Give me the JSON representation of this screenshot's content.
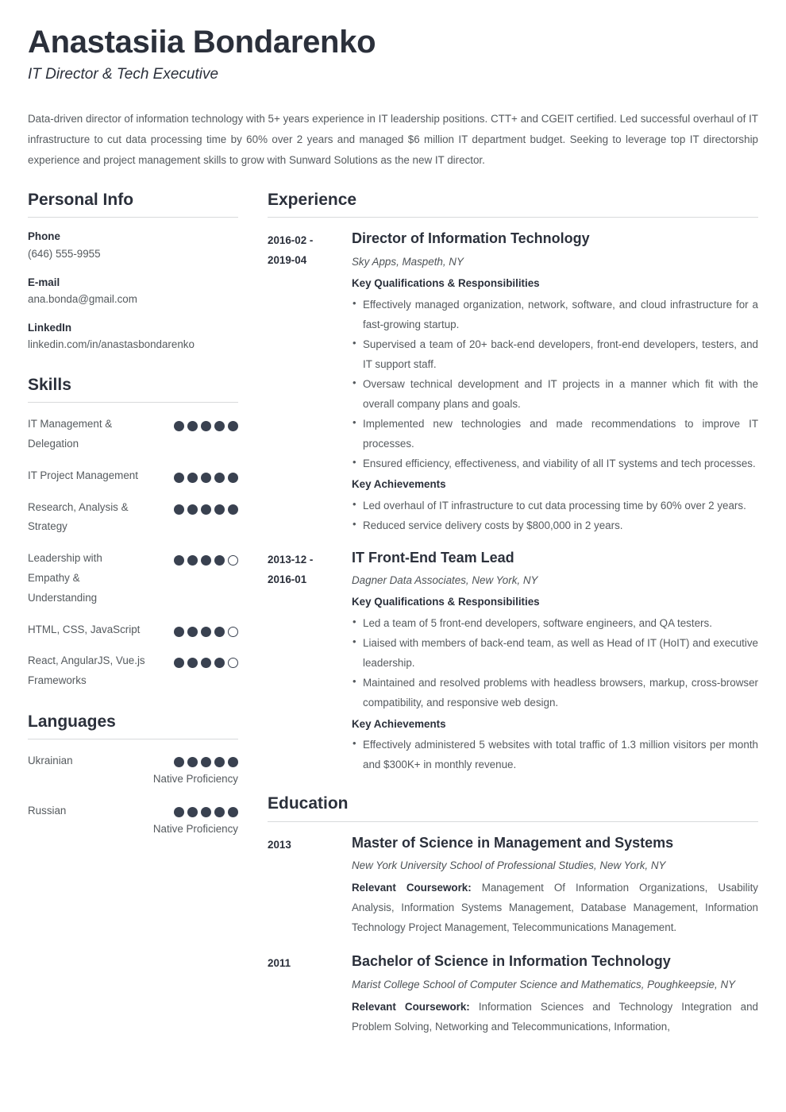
{
  "header": {
    "name": "Anastasiia Bondarenko",
    "title": "IT Director & Tech Executive",
    "summary": "Data-driven director of information technology with 5+ years experience in IT leadership positions. CTT+ and CGEIT certified. Led successful overhaul of IT infrastructure to cut data processing time by 60% over 2 years and managed $6 million IT department budget. Seeking to leverage top IT directorship experience and project management skills to grow with Sunward Solutions as the new IT director."
  },
  "sidebar": {
    "personal_info": {
      "heading": "Personal Info",
      "items": [
        {
          "label": "Phone",
          "value": "(646) 555-9955"
        },
        {
          "label": "E-mail",
          "value": "ana.bonda@gmail.com"
        },
        {
          "label": "LinkedIn",
          "value": "linkedin.com/in/anastasbondarenko"
        }
      ]
    },
    "skills": {
      "heading": "Skills",
      "max_rating": 5,
      "items": [
        {
          "name": "IT Management & Delegation",
          "rating": 5
        },
        {
          "name": "IT Project Management",
          "rating": 5
        },
        {
          "name": "Research, Analysis & Strategy",
          "rating": 5
        },
        {
          "name": "Leadership with Empathy & Understanding",
          "rating": 4
        },
        {
          "name": "HTML, CSS, JavaScript",
          "rating": 4
        },
        {
          "name": "React, AngularJS, Vue.js Frameworks",
          "rating": 4
        }
      ]
    },
    "languages": {
      "heading": "Languages",
      "max_rating": 5,
      "items": [
        {
          "name": "Ukrainian",
          "rating": 5,
          "level": "Native Proficiency"
        },
        {
          "name": "Russian",
          "rating": 5,
          "level": "Native Proficiency"
        }
      ]
    }
  },
  "main": {
    "experience": {
      "heading": "Experience",
      "entries": [
        {
          "date_line1": "2016-02 -",
          "date_line2": "2019-04",
          "role": "Director of Information Technology",
          "org": "Sky Apps, Maspeth, NY",
          "qual_heading": "Key Qualifications & Responsibilities",
          "qualifications": [
            "Effectively managed organization, network, software, and cloud infrastructure for a fast-growing startup.",
            "Supervised a team of 20+ back-end developers, front-end developers, testers, and IT support staff.",
            "Oversaw technical development and IT projects in a manner which fit with the overall company plans and goals.",
            "Implemented new technologies and made recommendations to improve IT processes.",
            "Ensured efficiency, effectiveness, and viability of all IT systems and tech processes."
          ],
          "ach_heading": "Key Achievements",
          "achievements": [
            "Led overhaul of IT infrastructure to cut data processing time by 60% over 2 years.",
            "Reduced service delivery costs by $800,000 in 2 years."
          ]
        },
        {
          "date_line1": "2013-12 -",
          "date_line2": "2016-01",
          "role": "IT Front-End Team Lead",
          "org": "Dagner Data Associates, New York, NY",
          "qual_heading": "Key Qualifications & Responsibilities",
          "qualifications": [
            "Led a team of 5 front-end developers, software engineers, and QA testers.",
            "Liaised with members of back-end team, as well as Head of IT (HoIT) and executive leadership.",
            "Maintained and resolved problems with headless browsers, markup, cross-browser compatibility, and responsive web design."
          ],
          "ach_heading": "Key Achievements",
          "achievements": [
            "Effectively administered 5 websites with total traffic of 1.3 million visitors per month and $300K+ in monthly revenue."
          ]
        }
      ]
    },
    "education": {
      "heading": "Education",
      "entries": [
        {
          "date": "2013",
          "degree": "Master of Science in Management and Systems",
          "school": "New York University School of Professional Studies, New York, NY",
          "coursework_label": "Relevant Coursework:",
          "coursework": "Management Of Information Organizations, Usability Analysis, Information Systems Management, Database Management, Information Technology Project Management, Telecommunications Management."
        },
        {
          "date": "2011",
          "degree": "Bachelor of Science in Information Technology",
          "school": "Marist College School of Computer Science and Mathematics, Poughkeepsie, NY",
          "coursework_label": "Relevant Coursework:",
          "coursework": "Information Sciences and Technology Integration and Problem Solving, Networking and Telecommunications, Information,"
        }
      ]
    }
  },
  "colors": {
    "heading": "#2b303b",
    "body": "#555a5e",
    "dot": "#394150",
    "rule": "#d8dadc"
  }
}
